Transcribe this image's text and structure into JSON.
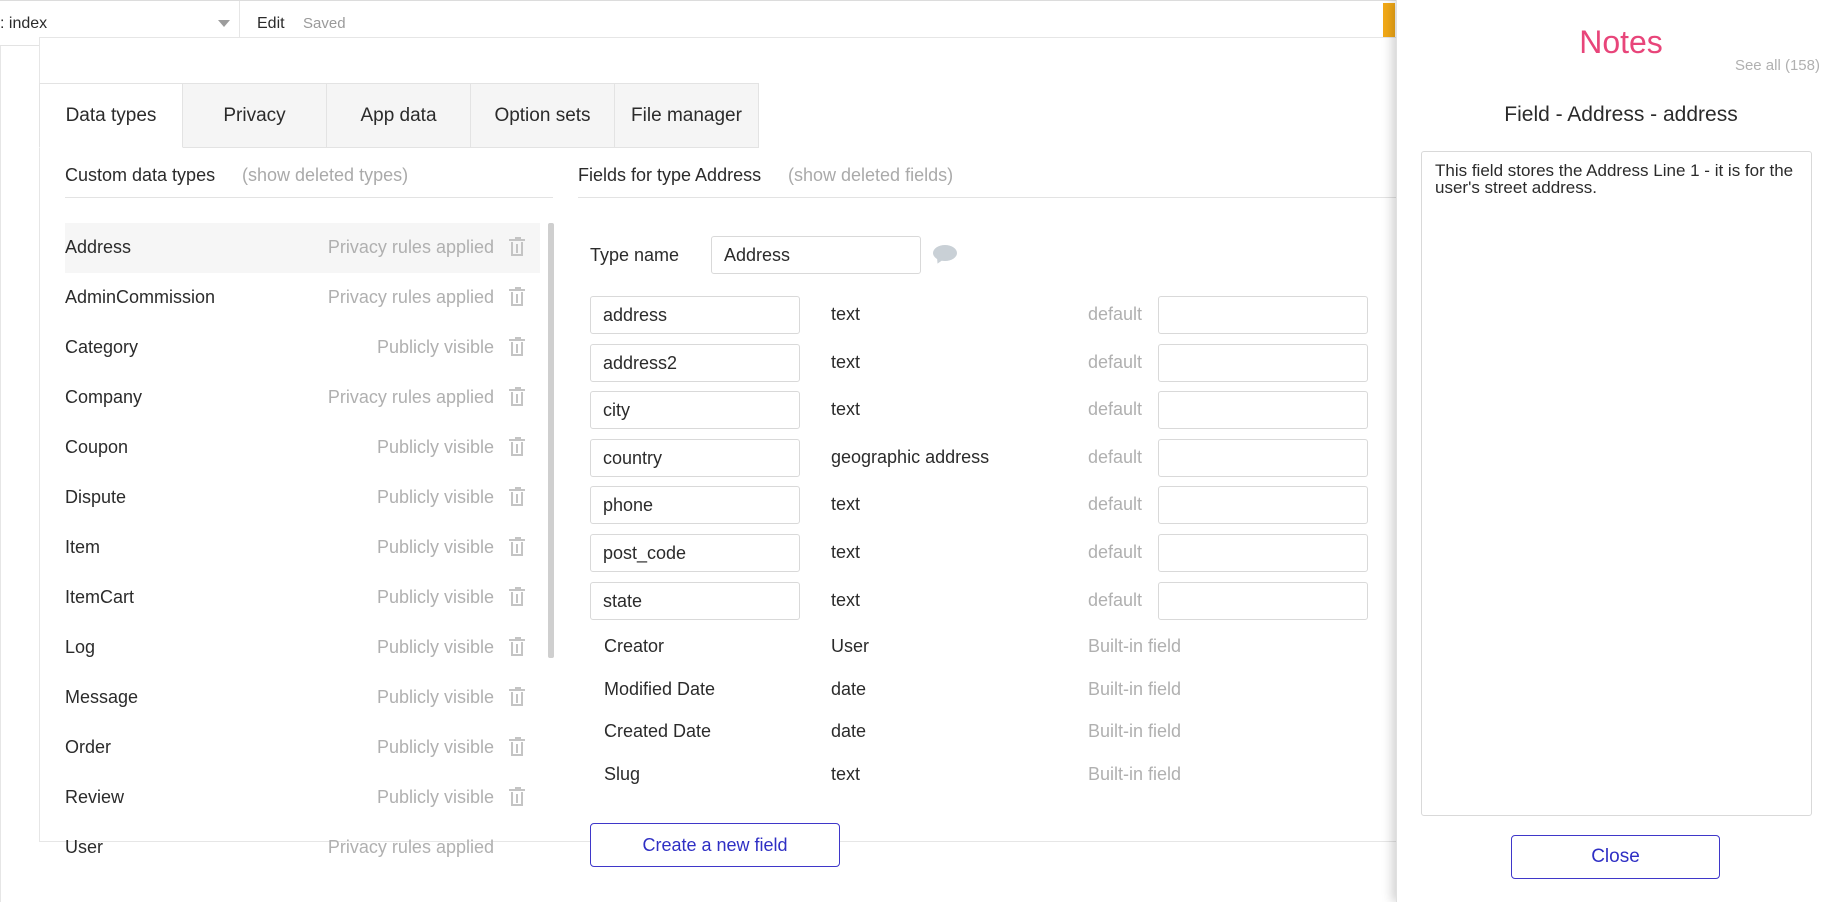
{
  "topbar": {
    "page_name": ": index",
    "edit_label": "Edit",
    "status": "Saved"
  },
  "tabs": [
    "Data types",
    "Privacy",
    "App data",
    "Option sets",
    "File manager"
  ],
  "custom_types": {
    "title": "Custom data types",
    "show_deleted": "(show deleted types)",
    "items": [
      {
        "name": "Address",
        "status": "Privacy rules applied"
      },
      {
        "name": "AdminCommission",
        "status": "Privacy rules applied"
      },
      {
        "name": "Category",
        "status": "Publicly visible"
      },
      {
        "name": "Company",
        "status": "Privacy rules applied"
      },
      {
        "name": "Coupon",
        "status": "Publicly visible"
      },
      {
        "name": "Dispute",
        "status": "Publicly visible"
      },
      {
        "name": "Item",
        "status": "Publicly visible"
      },
      {
        "name": "ItemCart",
        "status": "Publicly visible"
      },
      {
        "name": "Log",
        "status": "Publicly visible"
      },
      {
        "name": "Message",
        "status": "Publicly visible"
      },
      {
        "name": "Order",
        "status": "Publicly visible"
      },
      {
        "name": "Review",
        "status": "Publicly visible"
      },
      {
        "name": "User",
        "status": "Privacy rules applied"
      }
    ]
  },
  "fields_section": {
    "title": "Fields for type Address",
    "show_deleted": "(show deleted fields)",
    "type_name_label": "Type name",
    "type_name_value": "Address",
    "default_label": "default",
    "fields": [
      {
        "name": "address",
        "type": "text"
      },
      {
        "name": "address2",
        "type": "text"
      },
      {
        "name": "city",
        "type": "text"
      },
      {
        "name": "country",
        "type": "geographic address"
      },
      {
        "name": "phone",
        "type": "text"
      },
      {
        "name": "post_code",
        "type": "text"
      },
      {
        "name": "state",
        "type": "text"
      }
    ],
    "builtin_label": "Built-in field",
    "builtin_fields": [
      {
        "name": "Creator",
        "type": "User"
      },
      {
        "name": "Modified Date",
        "type": "date"
      },
      {
        "name": "Created Date",
        "type": "date"
      },
      {
        "name": "Slug",
        "type": "text"
      }
    ],
    "create_button": "Create a new field"
  },
  "notes": {
    "title": "Notes",
    "see_all": "See all (158)",
    "subtitle": "Field - Address - address",
    "text": "This field stores the Address Line 1 - it is for the user's street address.",
    "close_button": "Close"
  },
  "colors": {
    "accent_pink": "#e8457a",
    "button_blue": "#2f2fc4",
    "orange": "#f2a917"
  }
}
